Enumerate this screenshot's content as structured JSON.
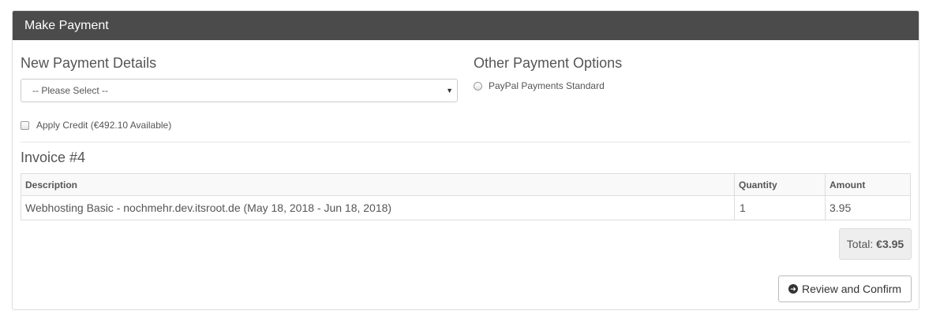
{
  "panel": {
    "title": "Make Payment"
  },
  "new_payment": {
    "heading": "New Payment Details",
    "select_value": "-- Please Select --",
    "caret_icon": "chevron-down-icon"
  },
  "other_payment": {
    "heading": "Other Payment Options",
    "options": [
      {
        "label": "PayPal Payments Standard",
        "selected": false
      }
    ]
  },
  "credit": {
    "label": "Apply Credit (€492.10 Available)",
    "checked": false
  },
  "invoice": {
    "title": "Invoice #4",
    "columns": [
      "Description",
      "Quantity",
      "Amount"
    ],
    "rows": [
      {
        "description": "Webhosting Basic - nochmehr.dev.itsroot.de (May 18, 2018 - Jun 18, 2018)",
        "quantity": "1",
        "amount": "3.95"
      }
    ],
    "total_label": "Total:",
    "total_value": "€3.95"
  },
  "actions": {
    "confirm_label": "Review and Confirm",
    "confirm_icon": "arrow-circle-right-icon"
  }
}
